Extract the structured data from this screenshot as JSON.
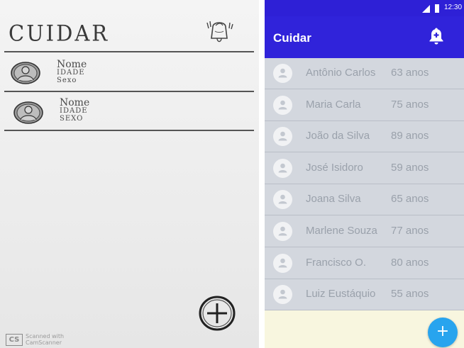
{
  "sketch": {
    "title": "CUIDAR",
    "rows": [
      {
        "nome": "Nome",
        "idade": "IDADE",
        "sexo": "Sexo"
      },
      {
        "nome": "Nome",
        "idade": "IDADE",
        "sexo": "SEXO"
      }
    ],
    "scanner_logo": "CS",
    "scanner_line1": "Scanned with",
    "scanner_line2": "CamScanner"
  },
  "phone": {
    "status_time": "12:30",
    "app_title": "Cuidar",
    "bell_icon": "bell-plus-icon",
    "fab_icon": "plus-icon",
    "fab_label": "+",
    "colors": {
      "status_bar": "#2e20d6",
      "app_bar": "#3023da",
      "list_bg": "#d3d7de",
      "page_bg": "#f8f6df",
      "fab": "#28a4ee"
    },
    "patients": [
      {
        "name": "Antônio Carlos",
        "age": "63 anos"
      },
      {
        "name": "Maria Carla",
        "age": "75 anos"
      },
      {
        "name": "João da Silva",
        "age": "89 anos"
      },
      {
        "name": "José Isidoro",
        "age": "59 anos"
      },
      {
        "name": "Joana Silva",
        "age": "65 anos"
      },
      {
        "name": "Marlene Souza",
        "age": "77 anos"
      },
      {
        "name": "Francisco O.",
        "age": "80 anos"
      },
      {
        "name": "Luiz Eustáquio",
        "age": "55 anos"
      }
    ]
  }
}
